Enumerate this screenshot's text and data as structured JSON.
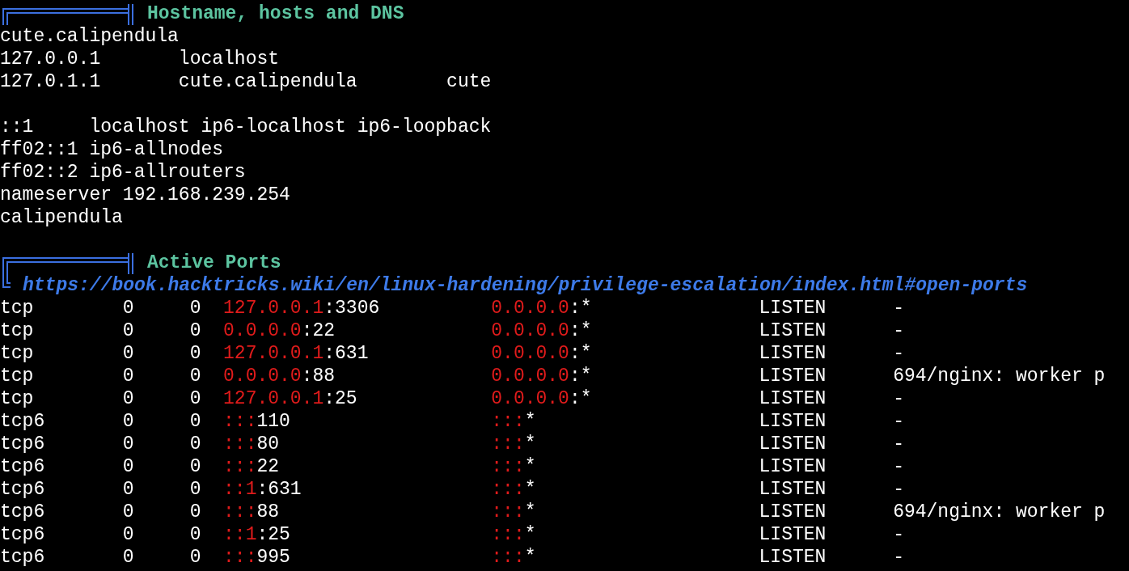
{
  "sections": [
    {
      "title": "Hostname, hosts and DNS",
      "paragraphs": [
        [
          "cute.calipendula",
          "127.0.0.1       localhost",
          "127.0.1.1       cute.calipendula        cute"
        ],
        [
          "::1     localhost ip6-localhost ip6-loopback",
          "ff02::1 ip6-allnodes",
          "ff02::2 ip6-allrouters",
          "nameserver 192.168.239.254",
          "calipendula"
        ]
      ]
    },
    {
      "title": "Active Ports",
      "link": "https://book.hacktricks.wiki/en/linux-hardening/privilege-escalation/index.html#open-ports",
      "ports": [
        {
          "proto": "tcp",
          "recv_q": "0",
          "send_q": "0",
          "local_host": "127.0.0.1",
          "local_port": ":3306",
          "foreign_host": "0.0.0.0",
          "foreign_port": ":*",
          "state": "LISTEN",
          "process": "-"
        },
        {
          "proto": "tcp",
          "recv_q": "0",
          "send_q": "0",
          "local_host": "0.0.0.0",
          "local_port": ":22",
          "foreign_host": "0.0.0.0",
          "foreign_port": ":*",
          "state": "LISTEN",
          "process": "-"
        },
        {
          "proto": "tcp",
          "recv_q": "0",
          "send_q": "0",
          "local_host": "127.0.0.1",
          "local_port": ":631",
          "foreign_host": "0.0.0.0",
          "foreign_port": ":*",
          "state": "LISTEN",
          "process": "-"
        },
        {
          "proto": "tcp",
          "recv_q": "0",
          "send_q": "0",
          "local_host": "0.0.0.0",
          "local_port": ":88",
          "foreign_host": "0.0.0.0",
          "foreign_port": ":*",
          "state": "LISTEN",
          "process": "694/nginx: worker p"
        },
        {
          "proto": "tcp",
          "recv_q": "0",
          "send_q": "0",
          "local_host": "127.0.0.1",
          "local_port": ":25",
          "foreign_host": "0.0.0.0",
          "foreign_port": ":*",
          "state": "LISTEN",
          "process": "-"
        },
        {
          "proto": "tcp6",
          "recv_q": "0",
          "send_q": "0",
          "local_host": ":::",
          "local_port": "110",
          "foreign_host": ":::",
          "foreign_port": "*",
          "state": "LISTEN",
          "process": "-"
        },
        {
          "proto": "tcp6",
          "recv_q": "0",
          "send_q": "0",
          "local_host": ":::",
          "local_port": "80",
          "foreign_host": ":::",
          "foreign_port": "*",
          "state": "LISTEN",
          "process": "-"
        },
        {
          "proto": "tcp6",
          "recv_q": "0",
          "send_q": "0",
          "local_host": ":::",
          "local_port": "22",
          "foreign_host": ":::",
          "foreign_port": "*",
          "state": "LISTEN",
          "process": "-"
        },
        {
          "proto": "tcp6",
          "recv_q": "0",
          "send_q": "0",
          "local_host": "::1",
          "local_port": ":631",
          "foreign_host": ":::",
          "foreign_port": "*",
          "state": "LISTEN",
          "process": "-"
        },
        {
          "proto": "tcp6",
          "recv_q": "0",
          "send_q": "0",
          "local_host": ":::",
          "local_port": "88",
          "foreign_host": ":::",
          "foreign_port": "*",
          "state": "LISTEN",
          "process": "694/nginx: worker p"
        },
        {
          "proto": "tcp6",
          "recv_q": "0",
          "send_q": "0",
          "local_host": "::1",
          "local_port": ":25",
          "foreign_host": ":::",
          "foreign_port": "*",
          "state": "LISTEN",
          "process": "-"
        },
        {
          "proto": "tcp6",
          "recv_q": "0",
          "send_q": "0",
          "local_host": ":::",
          "local_port": "995",
          "foreign_host": ":::",
          "foreign_port": "*",
          "state": "LISTEN",
          "process": "-"
        }
      ]
    }
  ]
}
